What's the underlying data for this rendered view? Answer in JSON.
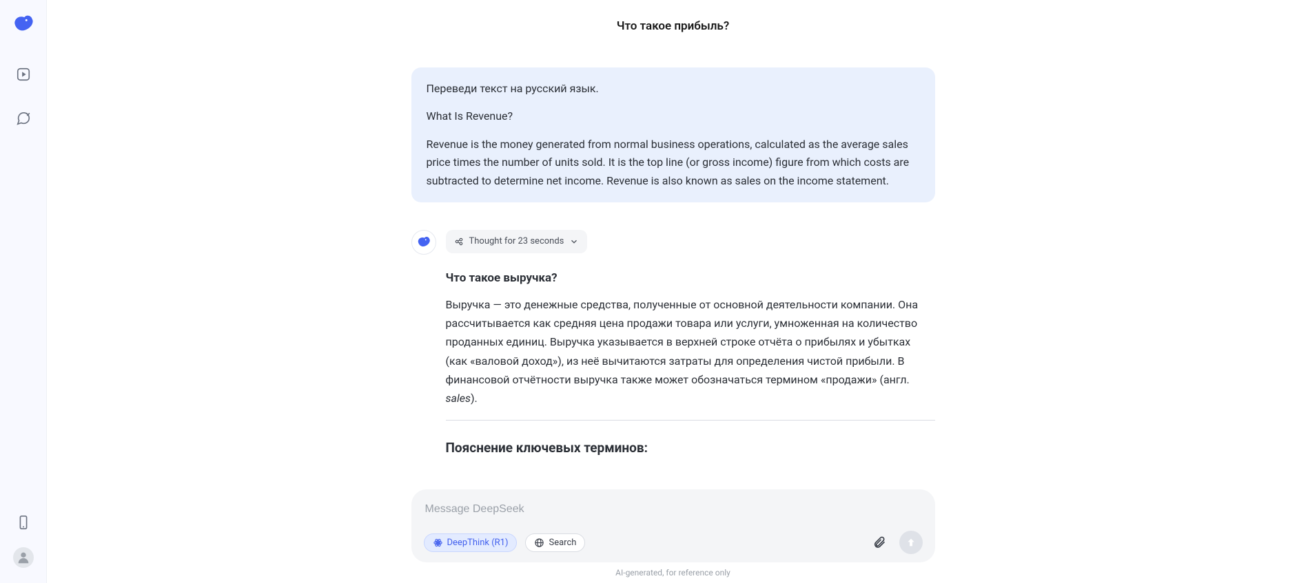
{
  "header": {
    "title": "Что такое прибыль?"
  },
  "user_message": {
    "line1": "Переведи текст на русский язык.",
    "line2": "What Is Revenue?",
    "line3": "Revenue is the money generated from normal business operations, calculated as the average sales price times the number of units sold. It is the top line (or gross income) figure from which costs are subtracted to determine net income. Revenue is also known as sales on the income statement."
  },
  "assistant": {
    "thought_label": "Thought for 23 seconds",
    "heading": "Что такое выручка?",
    "body_before_italic": "Выручка — это денежные средства, полученные от основной деятельности компании. Она рассчитывается как средняя цена продажи товара или услуги, умноженная на количество проданных единиц. Выручка указывается в верхней строке отчёта о прибылях и убытках (как «валовой доход»), из неё вычитаются затраты для определения чистой прибыли. В финансовой отчётности выручка также может обозначаться термином «продажи» (англ. ",
    "italic_term": "sales",
    "body_after_italic": ").",
    "subheading": "Пояснение ключевых терминов:"
  },
  "composer": {
    "placeholder": "Message DeepSeek",
    "deepthink_label": "DeepThink (R1)",
    "search_label": "Search"
  },
  "footnote": "AI-generated, for reference only"
}
